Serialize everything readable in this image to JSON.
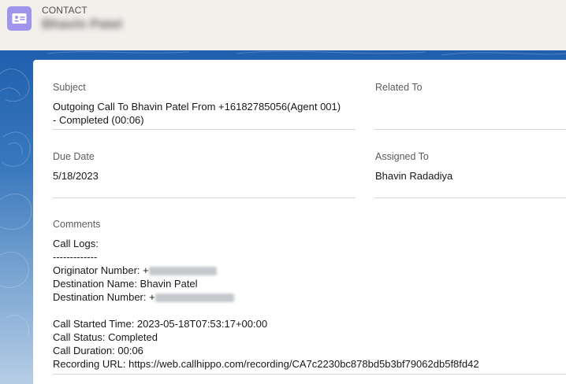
{
  "header": {
    "object_label": "CONTACT",
    "record_name": "Bhavin Patel"
  },
  "fields": {
    "subject": {
      "label": "Subject",
      "value_line1": "Outgoing Call To Bhavin Patel From +16182785056(Agent 001)",
      "value_line2": "- Completed (00:06)"
    },
    "related_to": {
      "label": "Related To",
      "value": ""
    },
    "due_date": {
      "label": "Due Date",
      "value": "5/18/2023"
    },
    "assigned_to": {
      "label": "Assigned To",
      "value": "Bhavin Radadiya"
    },
    "comments": {
      "label": "Comments",
      "call_logs": "Call Logs:",
      "separator": "-------------",
      "originator_number": "Originator Number: +",
      "destination_name": "Destination Name: Bhavin Patel",
      "destination_number": "Destination Number: +",
      "call_started_time": "Call Started Time: 2023-05-18T07:53:17+00:00",
      "call_status": "Call Status: Completed",
      "call_duration": "Call Duration: 00:06",
      "recording_url": "Recording URL: https://web.callhippo.com/recording/CA7c2230bc878bd5b3bf79062db5f8fd42"
    }
  },
  "icons": {
    "record_icon": "contact-card-icon"
  },
  "colors": {
    "header_bg": "#f3f0ec",
    "record_icon_bg": "#a094ed",
    "band_top": "#1f5fae",
    "band_bottom": "#b7cde6",
    "label_text": "#5c5c5c",
    "value_text": "#181818",
    "divider": "#d9d9d9"
  }
}
